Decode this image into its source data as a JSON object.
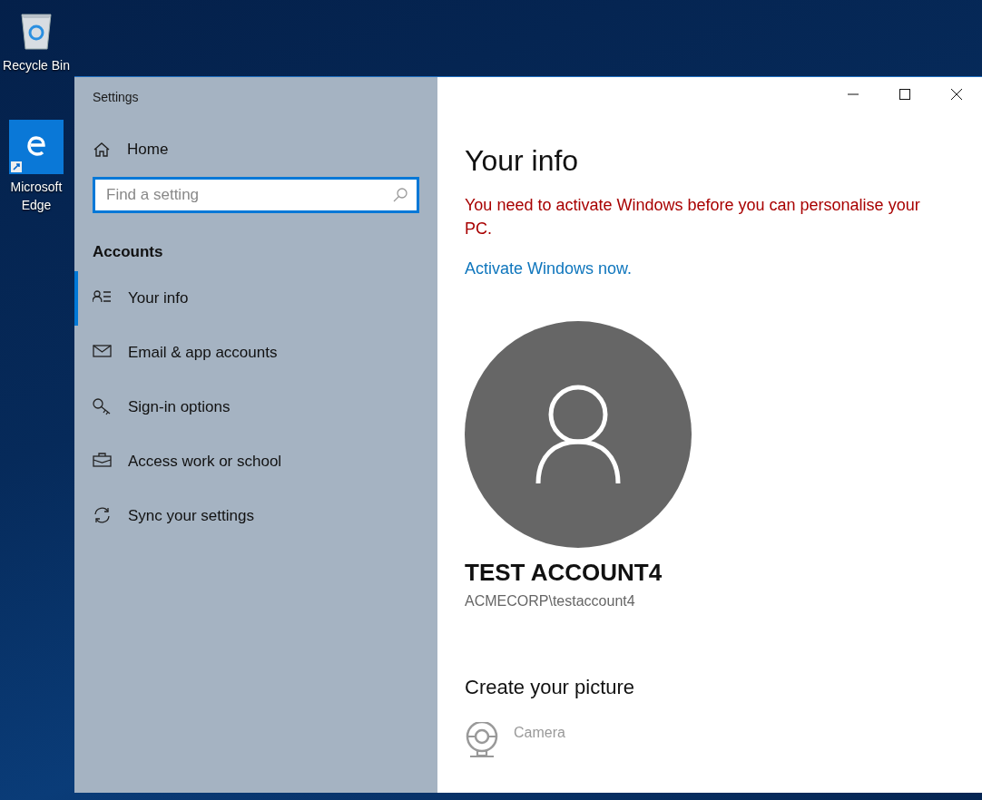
{
  "desktop_icons": [
    {
      "label": "Recycle Bin",
      "kind": "recycle"
    },
    {
      "label": "Microsoft Edge",
      "kind": "edge"
    }
  ],
  "window": {
    "title": "Settings"
  },
  "sidebar": {
    "home": "Home",
    "search": {
      "placeholder": "Find a setting"
    },
    "section": "Accounts",
    "items": [
      {
        "label": "Your info",
        "kind": "person",
        "selected": true
      },
      {
        "label": "Email & app accounts",
        "kind": "mail",
        "selected": false
      },
      {
        "label": "Sign-in options",
        "kind": "key",
        "selected": false
      },
      {
        "label": "Access work or school",
        "kind": "briefcase",
        "selected": false
      },
      {
        "label": "Sync your settings",
        "kind": "sync",
        "selected": false
      }
    ]
  },
  "content": {
    "title": "Your info",
    "warning": "You need to activate Windows before you can personalise your PC.",
    "link": "Activate Windows now.",
    "account_name": "TEST ACCOUNT4",
    "account_id": "ACMECORP\\testaccount4",
    "picture_heading": "Create your picture",
    "picture_options": [
      {
        "label": "Camera",
        "kind": "camera",
        "disabled": true
      }
    ]
  }
}
